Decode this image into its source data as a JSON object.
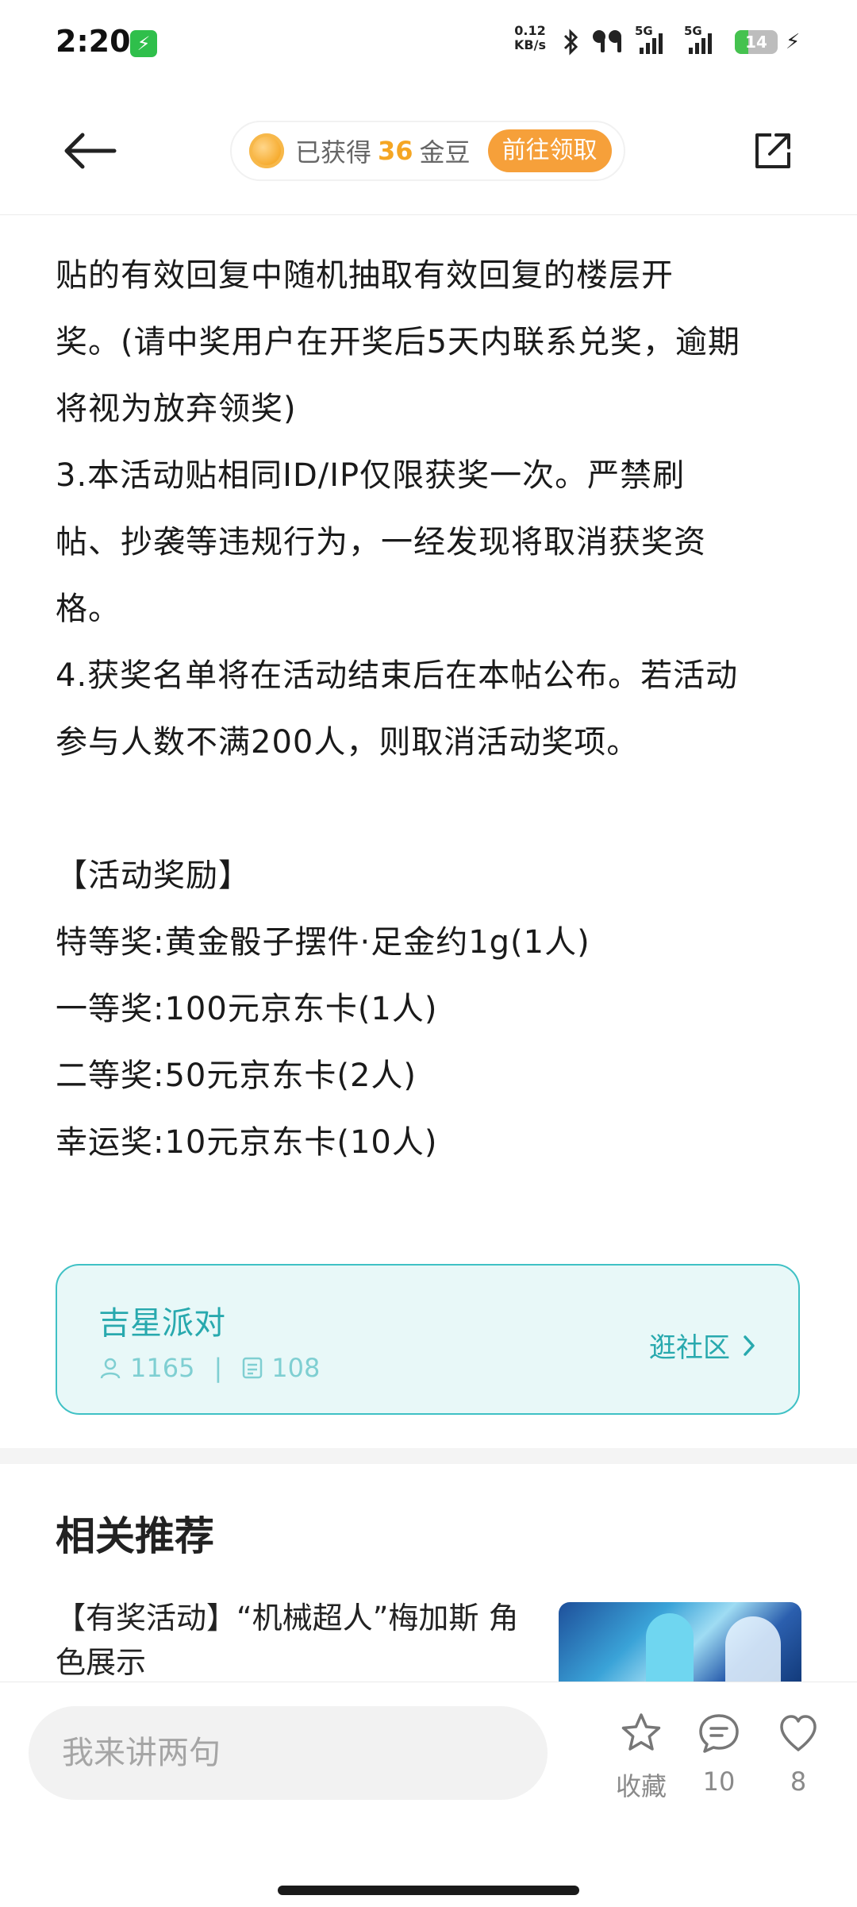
{
  "status_bar": {
    "time": "2:20",
    "net_speed_value": "0.12",
    "net_speed_unit": "KB/s",
    "sim1_label": "5G",
    "sim2_label": "5G",
    "battery_level": "14",
    "battery_fraction": 0.14
  },
  "header": {
    "coin_prefix": "已获得",
    "coin_count": "36",
    "coin_suffix": "金豆",
    "claim_button": "前往领取"
  },
  "article": {
    "lines": [
      "贴的有效回复中随机抽取有效回复的楼层开",
      "奖。(请中奖用户在开奖后5天内联系兑奖，逾期",
      "将视为放弃领奖)",
      "3.本活动贴相同ID/IP仅限获奖一次。严禁刷",
      "帖、抄袭等违规行为，一经发现将取消获奖资",
      "格。",
      "4.获奖名单将在活动结束后在本帖公布。若活动",
      "参与人数不满200人，则取消活动奖项。"
    ],
    "rewards_heading": "【活动奖励】",
    "rewards": [
      "特等奖:黄金骰子摆件·足金约1g(1人)",
      "一等奖:100元京东卡(1人)",
      "二等奖:50元京东卡(2人)",
      "幸运奖:10元京东卡(10人)"
    ]
  },
  "community": {
    "name": "吉星派对",
    "members": "1165",
    "posts": "108",
    "separator": "|",
    "visit_label": "逛社区"
  },
  "recommendations": {
    "title": "相关推荐",
    "items": [
      {
        "title": "【有奖活动】“机械超人”梅加斯 角色展示"
      }
    ]
  },
  "bottom_bar": {
    "comment_placeholder": "我来讲两句",
    "favorite_label": "收藏",
    "comment_count": "10",
    "like_count": "8"
  },
  "colors": {
    "accent_orange": "#f6a03a",
    "community_teal": "#28a9ae",
    "community_bg": "#e8f8f8"
  }
}
